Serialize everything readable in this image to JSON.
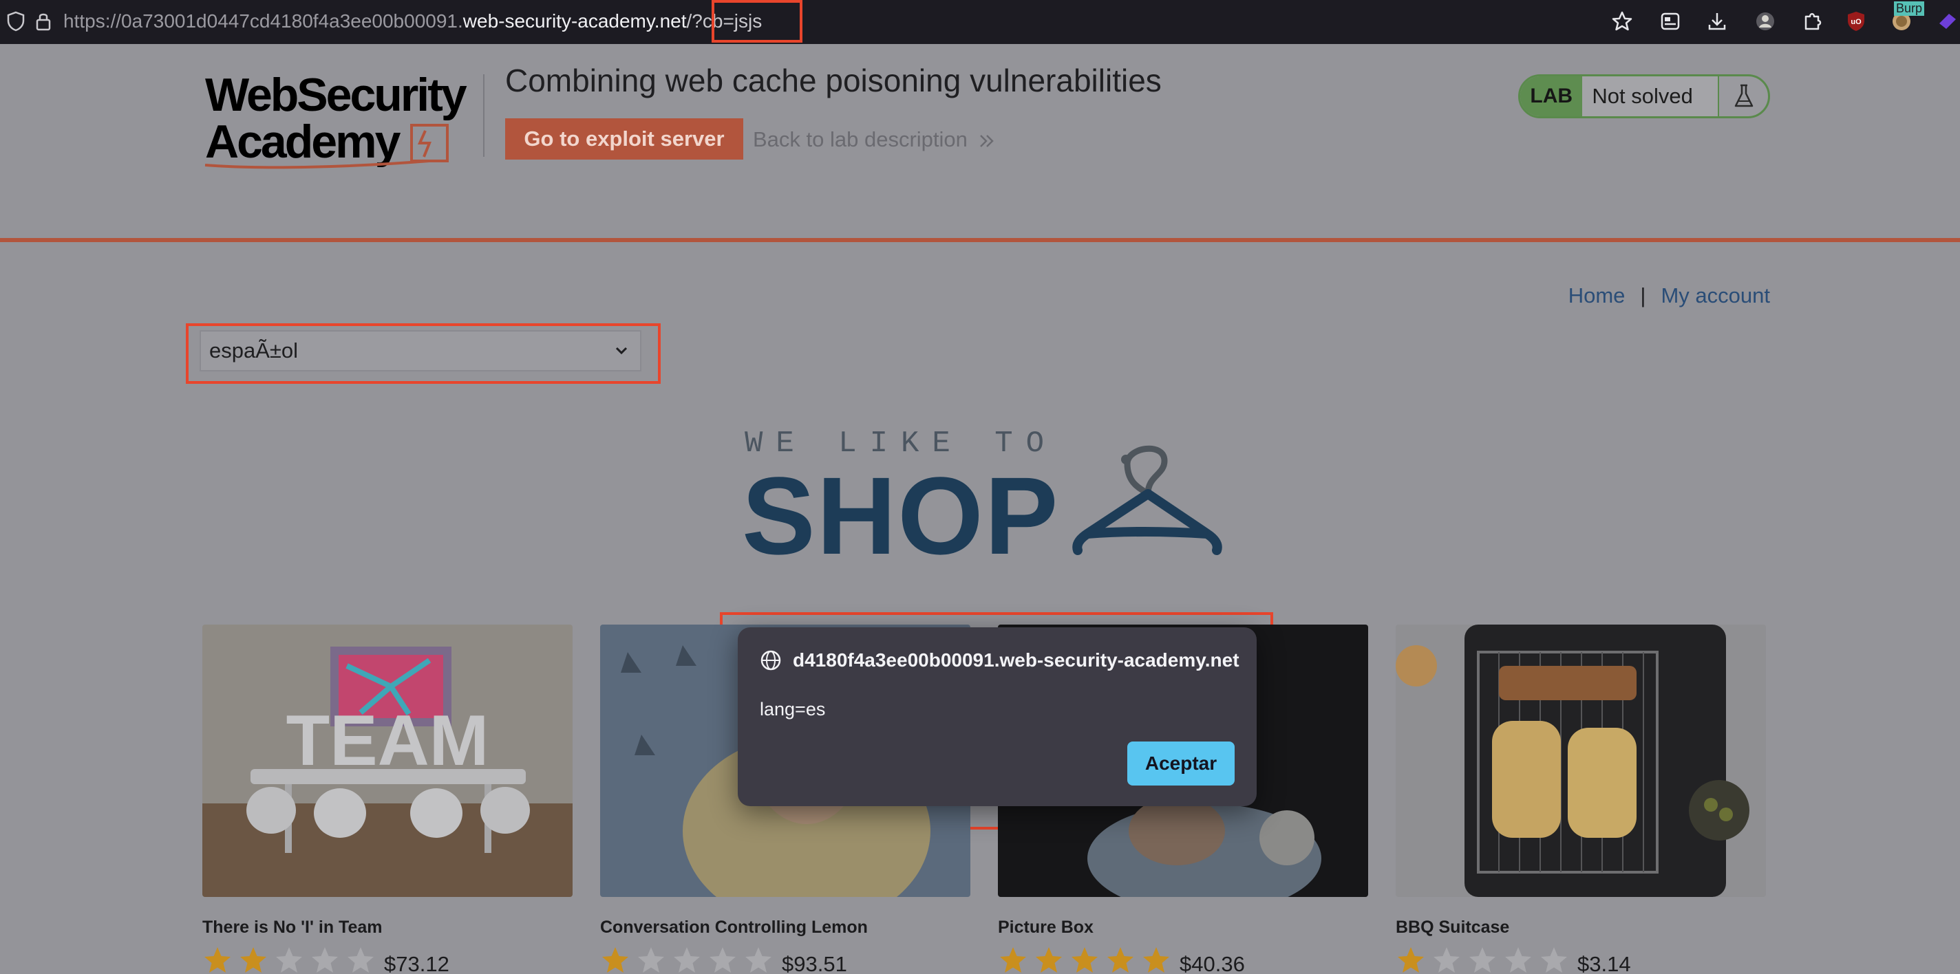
{
  "browser": {
    "url_prefix": "https://0a73001d0447cd4180f4a3ee00b00091.",
    "url_domain": "web-security-academy.net",
    "url_query": "/?cb=jsjs",
    "toolbar_icons": [
      "star-icon",
      "reader-icon",
      "download-icon",
      "profile-icon",
      "extensions-icon",
      "ublock-icon",
      "burp-icon",
      "extension-badge-icon"
    ],
    "burp_label": "Burp"
  },
  "lab": {
    "logo_line1": "WebSecurity",
    "logo_line2": "Academy",
    "title": "Combining web cache poisoning vulnerabilities",
    "exploit_button": "Go to exploit server",
    "back_link": "Back to lab description",
    "badge_label": "LAB",
    "status": "Not solved"
  },
  "nav": {
    "home": "Home",
    "separator": "|",
    "account": "My account"
  },
  "language_select": {
    "value": "espaÃ±ol"
  },
  "banner": {
    "small": "WE LIKE TO",
    "big": "SHOP"
  },
  "products": [
    {
      "name": "There is No 'I' in Team",
      "rating": 2,
      "price": "$73.12"
    },
    {
      "name": "Conversation Controlling Lemon",
      "rating": 1,
      "price": "$93.51"
    },
    {
      "name": "Picture Box",
      "rating": 5,
      "price": "$40.36"
    },
    {
      "name": "BBQ Suitcase",
      "rating": 1,
      "price": "$3.14"
    }
  ],
  "dialog": {
    "origin": "d4180f4a3ee00b00091.web-security-academy.net",
    "message": "lang=es",
    "ok_button": "Aceptar"
  },
  "colors": {
    "highlight": "#e8452c",
    "exploit_button": "#b2553d",
    "lab_badge": "#5e8d50",
    "dialog_button": "#58c5f0",
    "star": "#c98f1e"
  }
}
